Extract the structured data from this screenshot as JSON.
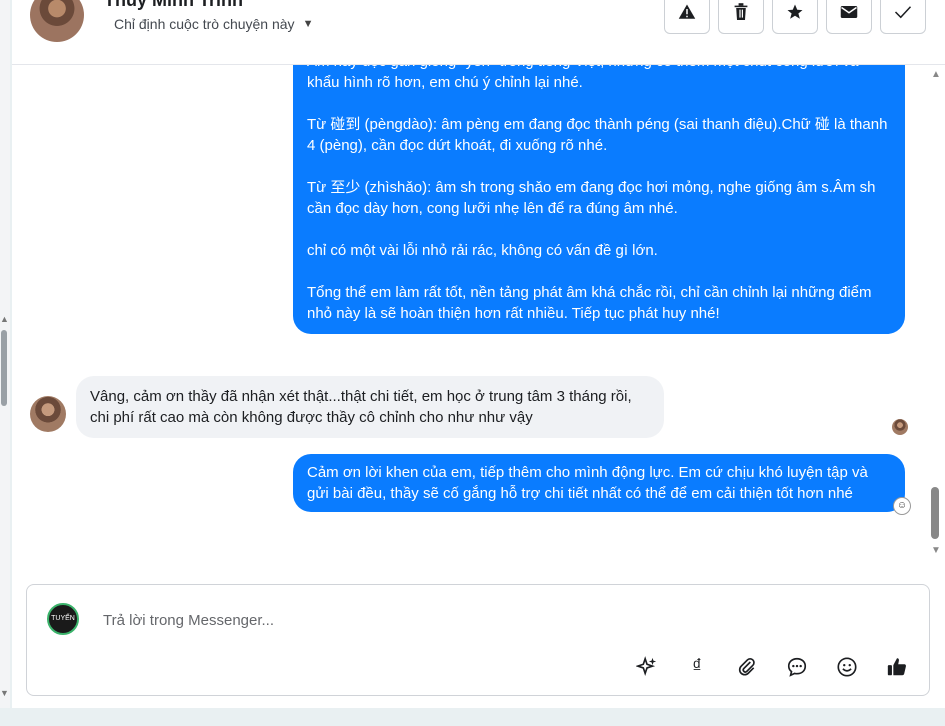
{
  "header": {
    "name": "Thúy Minh Trinh",
    "assign_label": "Chỉ định cuộc trò chuyện này",
    "actions": [
      {
        "name": "report",
        "icon": "warning-icon"
      },
      {
        "name": "delete",
        "icon": "trash-icon"
      },
      {
        "name": "star",
        "icon": "star-icon"
      },
      {
        "name": "mark-unread",
        "icon": "envelope-icon"
      },
      {
        "name": "done",
        "icon": "check-icon"
      }
    ]
  },
  "messages": [
    {
      "direction": "outgoing",
      "paragraphs": [
        "Âm này đọc gần giống \"yên\" trong tiếng Việt, nhưng có thêm một chút cong lưỡi và khẩu hình rõ hơn, em chú ý chỉnh lại nhé.",
        "Từ 碰到 (pèngdào): âm pèng em đang đọc thành péng (sai thanh điệu).Chữ 碰 là thanh 4 (pèng), cần đọc dứt khoát, đi xuống rõ nhé.",
        "Từ 至少 (zhìshǎo): âm sh trong shǎo em đang đọc hơi mỏng, nghe giống âm s.Âm sh cần đọc dày hơn, cong lưỡi nhẹ lên để ra đúng âm nhé.",
        "chỉ có một vài lỗi nhỏ rải rác, không có vấn đề gì lớn.",
        "Tổng thể em làm rất tốt, nền tảng phát âm khá chắc rồi, chỉ cần chỉnh lại những điểm nhỏ này là sẽ hoàn thiện hơn rất nhiều. Tiếp tục phát huy nhé!"
      ]
    },
    {
      "direction": "incoming",
      "text": "Vâng, cảm ơn thầy đã nhận xét thật...thật chi tiết, em học ở trung tâm 3 tháng rồi, chi phí rất cao mà còn không được thầy cô chỉnh cho như như vậy"
    },
    {
      "direction": "outgoing",
      "text": "Cảm ơn lời khen của em, tiếp thêm cho mình động lực. Em cứ chịu khó luyện tập và gửi bài đều, thầy sẽ cố gắng hỗ trợ chi tiết nhất có thể để em cải thiện tốt hơn nhé"
    }
  ],
  "composer": {
    "placeholder": "Trả lời trong Messenger...",
    "avatar_text": "TUYẾN",
    "tools": [
      {
        "name": "ai-assist",
        "icon": "sparkle-icon"
      },
      {
        "name": "currency",
        "icon": "dong-icon",
        "glyph": "₫"
      },
      {
        "name": "attach",
        "icon": "paperclip-icon"
      },
      {
        "name": "saved-replies",
        "icon": "chat-bubble-icon"
      },
      {
        "name": "emoji",
        "icon": "smiley-icon"
      },
      {
        "name": "like",
        "icon": "thumbs-up-icon"
      }
    ]
  },
  "colors": {
    "outgoing_bubble": "#0a7cff",
    "incoming_bubble": "#f0f2f5"
  }
}
